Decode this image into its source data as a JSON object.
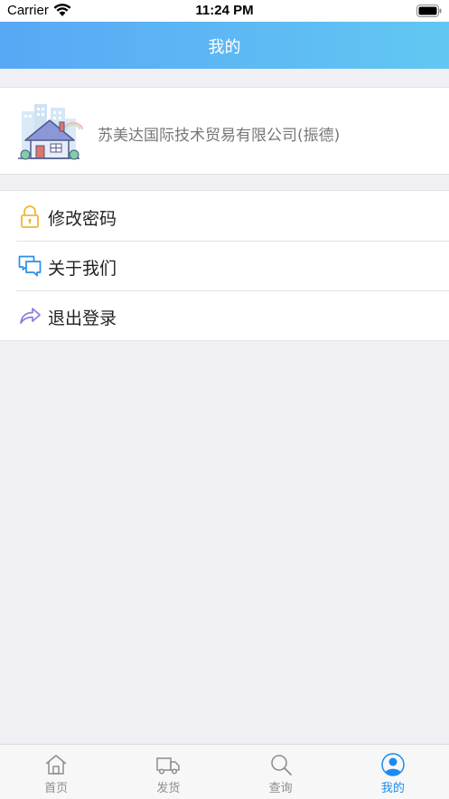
{
  "status_bar": {
    "carrier": "Carrier",
    "time": "11:24 PM"
  },
  "nav": {
    "title": "我的"
  },
  "profile": {
    "company_name": "苏美达国际技术贸易有限公司(振德)"
  },
  "menu": {
    "items": [
      {
        "label": "修改密码",
        "icon": "lock-icon"
      },
      {
        "label": "关于我们",
        "icon": "chat-bubbles-icon"
      },
      {
        "label": "退出登录",
        "icon": "share-arrow-icon"
      }
    ]
  },
  "tabs": [
    {
      "label": "首页",
      "icon": "home-icon"
    },
    {
      "label": "发货",
      "icon": "truck-icon"
    },
    {
      "label": "查询",
      "icon": "search-icon"
    },
    {
      "label": "我的",
      "icon": "user-icon",
      "active": true
    }
  ],
  "colors": {
    "accent": "#1a8cf0",
    "nav_start": "#58a8f5",
    "nav_end": "#62c7f2"
  }
}
